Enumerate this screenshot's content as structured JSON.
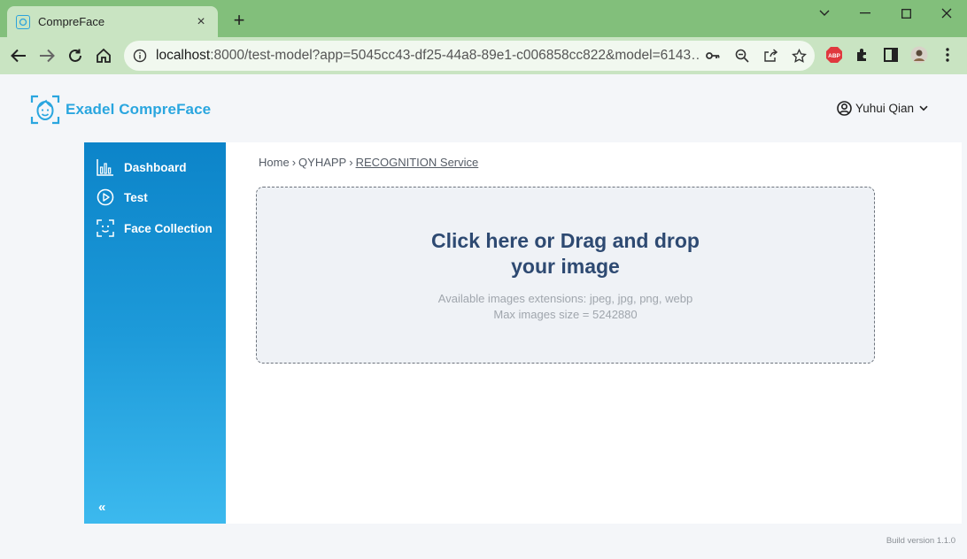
{
  "browser": {
    "tab_title": "CompreFace",
    "url_host": "localhost",
    "url_rest": ":8000/test-model?app=5045cc43-df25-44a8-89e1-c006858cc822&model=6143…",
    "ext_abp_label": "ABP"
  },
  "header": {
    "logo_text": "Exadel CompreFace",
    "user_name": "Yuhui Qian"
  },
  "sidebar": {
    "items": [
      {
        "label": "Dashboard",
        "icon": "bar-chart-icon"
      },
      {
        "label": "Test",
        "icon": "play-circle-icon"
      },
      {
        "label": "Face Collection",
        "icon": "face-scan-icon"
      }
    ],
    "collapse_label": "«"
  },
  "breadcrumb": {
    "home": "Home",
    "sep1": "›",
    "app": "QYHAPP",
    "sep2": "›",
    "current": "RECOGNITION Service"
  },
  "dropzone": {
    "title_line1": "Click here or Drag and drop",
    "title_line2": "your image",
    "extensions": "Available images extensions: jpeg, jpg, png, webp",
    "max_size": "Max images size = 5242880"
  },
  "footer": {
    "build": "Build version 1.1.0"
  },
  "colors": {
    "brand": "#2aa6df",
    "sidebar_top": "#0c84c9",
    "sidebar_bottom": "#3cb9ee",
    "dropzone_title": "#2e4a72",
    "browser_frame": "#82bf7b"
  }
}
